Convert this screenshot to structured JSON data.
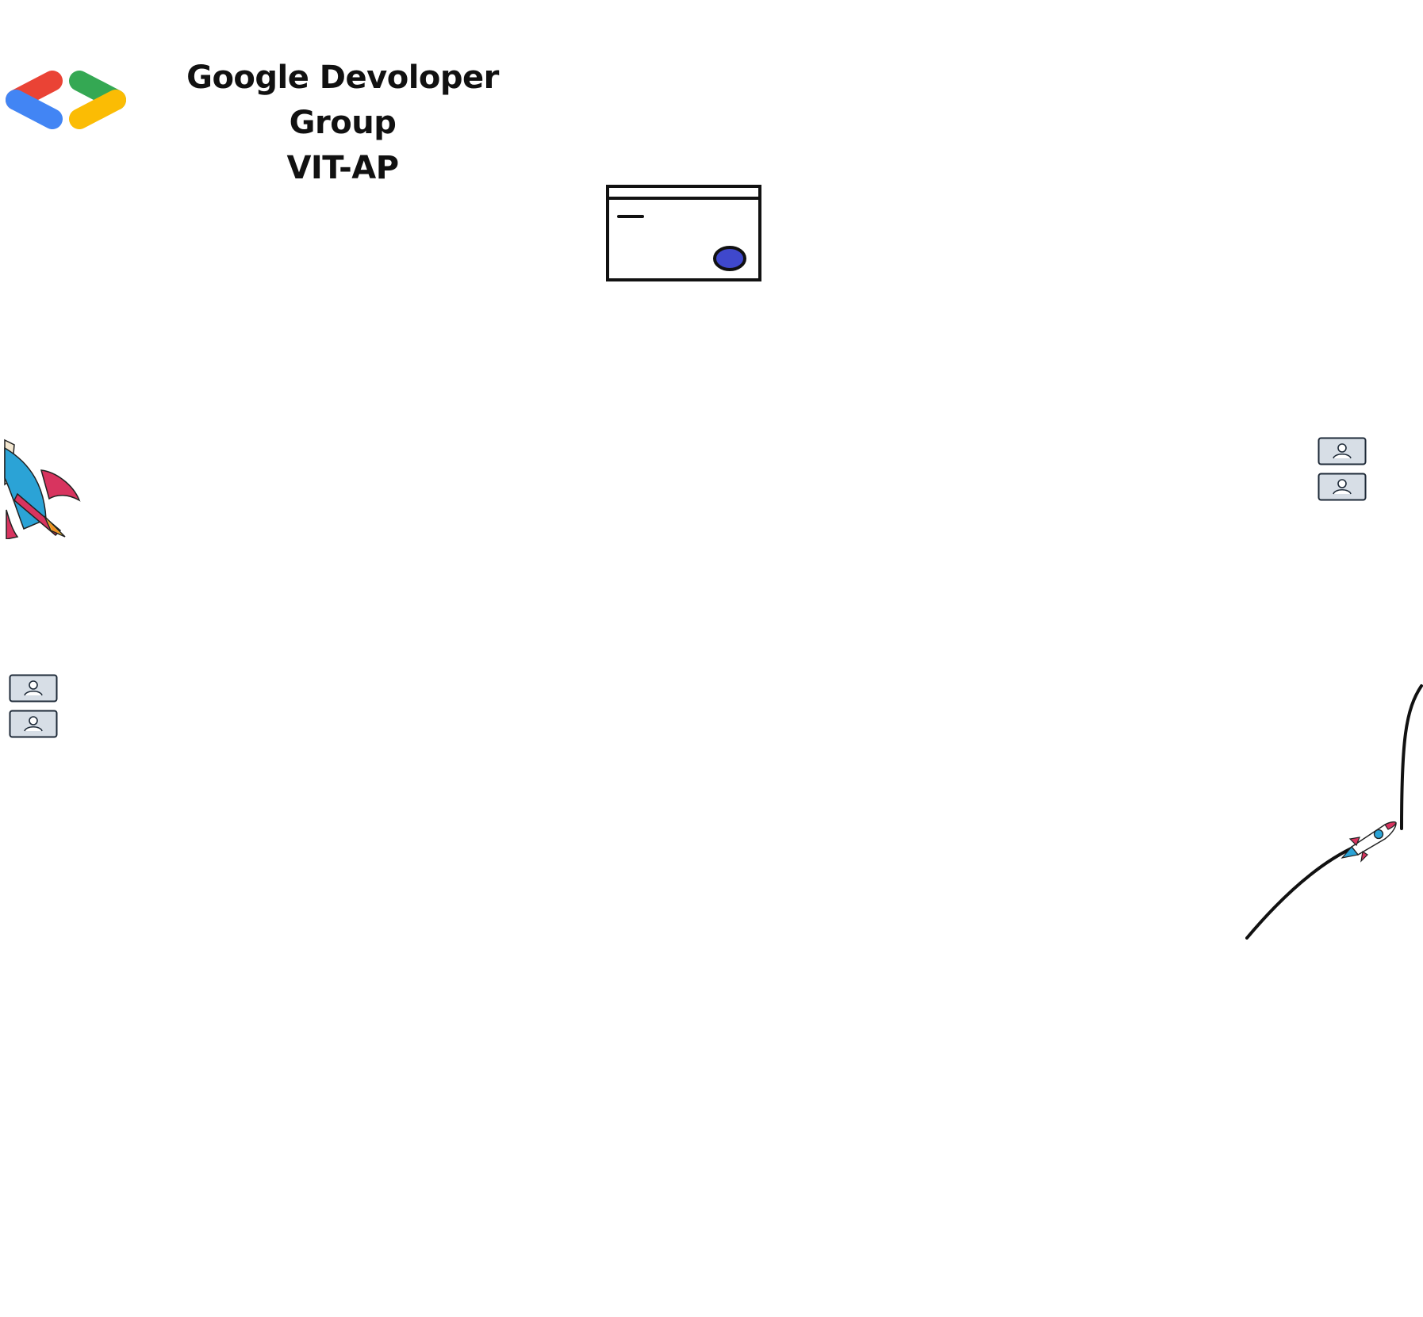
{
  "brand": {
    "title_line1": "Google Devoloper Group",
    "title_line2": "VIT-AP",
    "logo_colors": {
      "red": "#EA4335",
      "blue": "#4285F4",
      "green": "#34A853",
      "yellow": "#FBBC04"
    }
  },
  "illustrations": {
    "browser_window_icon": "browser-window-icon",
    "browser_button_color": "#3F48CC",
    "rocket_large": "rocket-icon",
    "rocket_small": "rocket-icon",
    "flight_path": "trajectory-line",
    "avatar_cards_right": [
      "user-card-icon",
      "user-card-icon"
    ],
    "avatar_cards_left": [
      "user-card-icon",
      "user-card-icon"
    ]
  }
}
